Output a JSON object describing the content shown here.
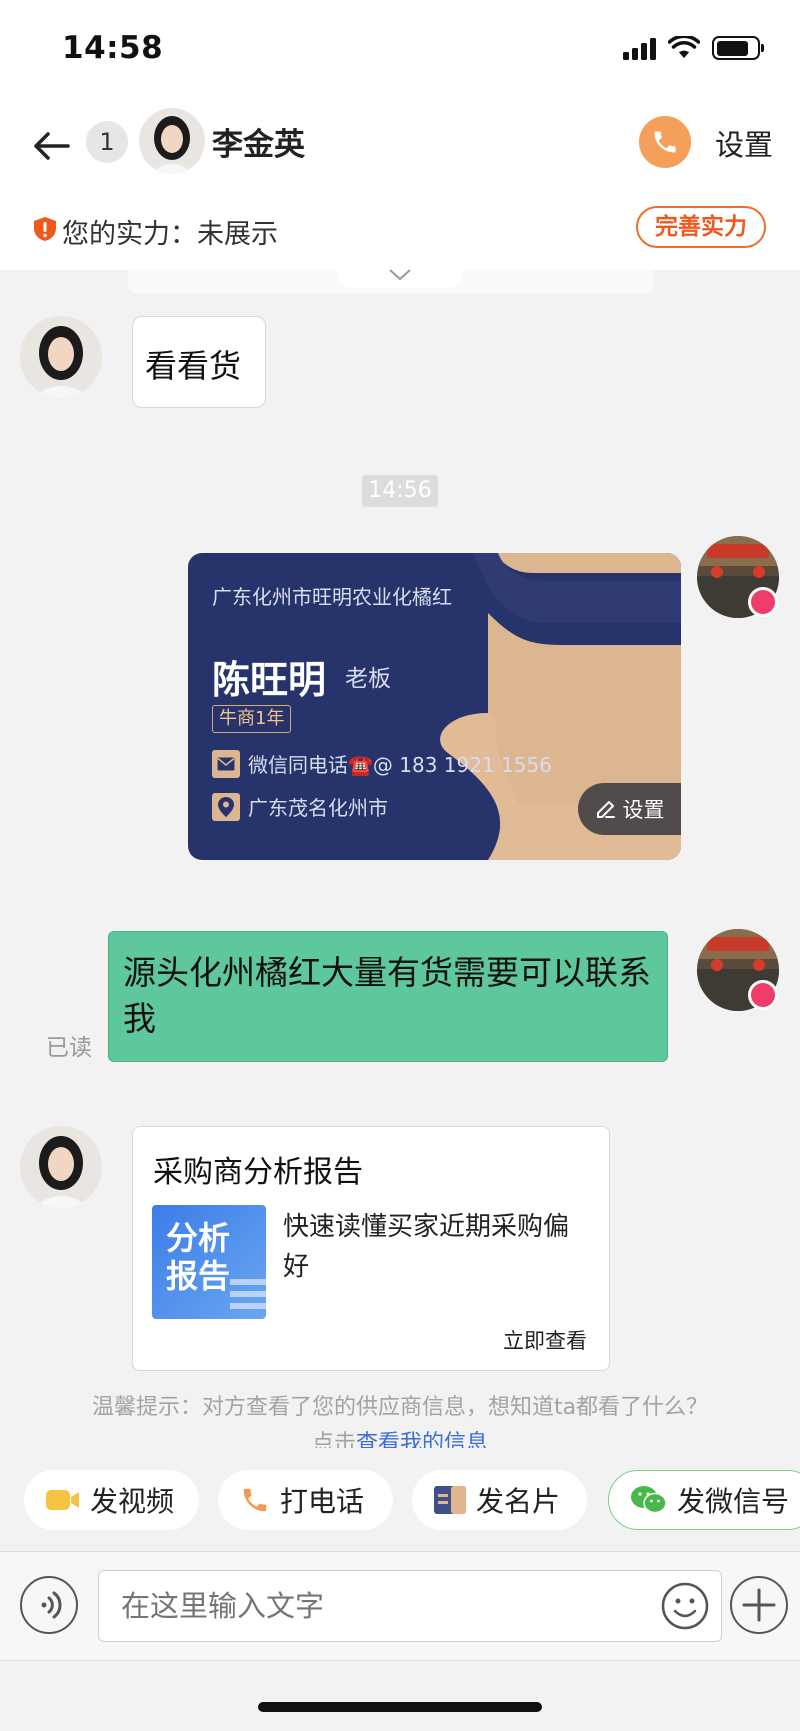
{
  "status_bar": {
    "time": "14:58"
  },
  "header": {
    "unread_count": "1",
    "contact_name": "李金英",
    "settings_label": "设置",
    "power_label": "您的实力：未展示",
    "improve_button": "完善实力"
  },
  "messages": {
    "first_incoming": "看看货",
    "timestamp": "14:56",
    "business_card": {
      "company": "广东化州市旺明农业化橘红",
      "name": "陈旺明",
      "role": "老板",
      "badge": "牛商1年",
      "contact": "微信同电话☎️@ 183 1921 1556",
      "location": "广东茂名化州市",
      "settings_button": "设置"
    },
    "outgoing_text": "源头化州橘红大量有货需要可以联系我",
    "read_status": "已读",
    "report_card": {
      "title": "采购商分析报告",
      "thumb_text": "分析报告",
      "description": "快速读懂买家近期采购偏好",
      "link": "立即查看"
    }
  },
  "tip": {
    "text": "温馨提示：对方查看了您的供应商信息，想知道ta都看了什么？",
    "prefix": "点击",
    "link": "查看我的信息"
  },
  "quick_actions": [
    {
      "label": "发视频",
      "icon": "video-icon",
      "color": "#f5c242"
    },
    {
      "label": "打电话",
      "icon": "phone-icon",
      "color": "#f29a55"
    },
    {
      "label": "发名片",
      "icon": "business-card-icon",
      "color": "#3f4f8c"
    },
    {
      "label": "发微信号",
      "icon": "wechat-icon",
      "color": "#48b84a"
    }
  ],
  "input": {
    "placeholder": "在这里输入文字"
  },
  "colors": {
    "accent_orange": "#ee5a1e",
    "sent_bubble": "#5ec79c",
    "card_navy": "#27346b",
    "link_blue": "#3a6fd8"
  }
}
